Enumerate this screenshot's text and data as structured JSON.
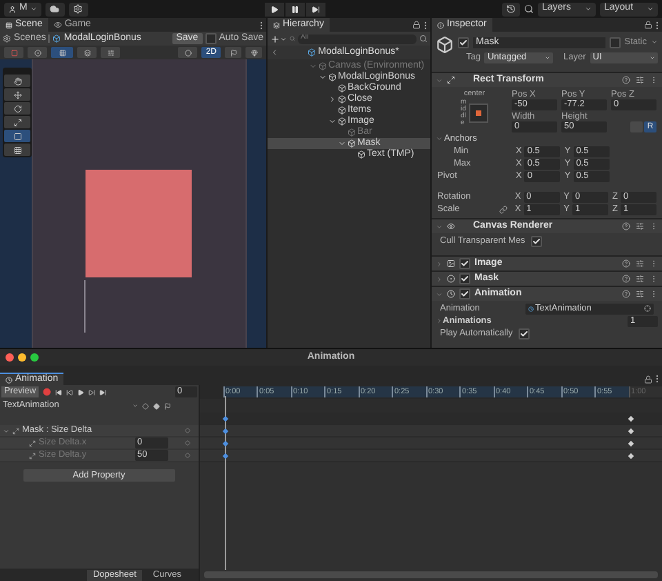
{
  "toolbar": {
    "account": "M",
    "layers": "Layers",
    "layout": "Layout"
  },
  "scene": {
    "tabs": [
      {
        "label": "Scene",
        "selected": true
      },
      {
        "label": "Game",
        "selected": false
      }
    ],
    "breadcrumb": [
      "Scenes",
      "ModalLoginBonus"
    ],
    "save": "Save",
    "auto_save": {
      "label": "Auto Save",
      "checked": false
    },
    "toggle_2d": {
      "label": "2D",
      "on": true
    },
    "tools": [
      {
        "kind": "hand",
        "selected": false
      },
      {
        "kind": "move",
        "selected": false
      },
      {
        "kind": "rotate",
        "selected": false
      },
      {
        "kind": "scale",
        "selected": false
      },
      {
        "kind": "rect",
        "selected": true
      },
      {
        "kind": "transform",
        "selected": false
      }
    ]
  },
  "hierarchy": {
    "title": "Hierarchy",
    "search": {
      "placeholder": "All"
    },
    "prefab": "ModalLoginBonus*",
    "tree": [
      {
        "label": "Canvas (Environment)",
        "disabled": true,
        "selected": false,
        "expanded": true,
        "children": [
          {
            "label": "ModalLoginBonus",
            "disabled": false,
            "selected": false,
            "expanded": true,
            "children": [
              {
                "label": "BackGround",
                "disabled": false,
                "selected": false
              },
              {
                "label": "Close",
                "disabled": false,
                "selected": false,
                "expanded": false
              },
              {
                "label": "Items",
                "disabled": false,
                "selected": false
              },
              {
                "label": "Image",
                "disabled": false,
                "selected": false,
                "expanded": true,
                "children": [
                  {
                    "label": "Bar",
                    "disabled": true,
                    "selected": false
                  },
                  {
                    "label": "Mask",
                    "disabled": false,
                    "selected": true,
                    "expanded": true,
                    "children": [
                      {
                        "label": "Text (TMP)",
                        "disabled": false,
                        "selected": false
                      }
                    ]
                  }
                ]
              }
            ]
          }
        ]
      }
    ]
  },
  "inspector": {
    "title": "Inspector",
    "object": {
      "name": "Mask",
      "active": true,
      "static": {
        "label": "Static",
        "checked": false
      },
      "tag": {
        "label": "Tag",
        "value": "Untagged"
      },
      "layer": {
        "label": "Layer",
        "value": "UI"
      }
    },
    "rect_transform": {
      "title": "Rect Transform",
      "expanded": true,
      "anchor_h": "center",
      "anchor_v": "middle",
      "raw_button": "R",
      "fields": [
        {
          "label": "Pos X",
          "value": "-50"
        },
        {
          "label": "Pos Y",
          "value": "-77.2"
        },
        {
          "label": "Pos Z",
          "value": "0"
        },
        {
          "label": "Width",
          "value": "0"
        },
        {
          "label": "Height",
          "value": "50"
        }
      ],
      "anchors": {
        "label": "Anchors",
        "expanded": true,
        "rows": [
          {
            "label": "Min",
            "axes": [
              {
                "axis": "X",
                "value": "0.5"
              },
              {
                "axis": "Y",
                "value": "0.5"
              }
            ]
          },
          {
            "label": "Max",
            "axes": [
              {
                "axis": "X",
                "value": "0.5"
              },
              {
                "axis": "Y",
                "value": "0.5"
              }
            ]
          }
        ]
      },
      "rows": [
        {
          "label": "Pivot",
          "linked": false,
          "axes": [
            {
              "axis": "X",
              "value": "0"
            },
            {
              "axis": "Y",
              "value": "0.5"
            }
          ]
        },
        {
          "label": "Rotation",
          "linked": false,
          "axes": [
            {
              "axis": "X",
              "value": "0"
            },
            {
              "axis": "Y",
              "value": "0"
            },
            {
              "axis": "Z",
              "value": "0"
            }
          ]
        },
        {
          "label": "Scale",
          "linked": true,
          "axes": [
            {
              "axis": "X",
              "value": "1"
            },
            {
              "axis": "Y",
              "value": "1"
            },
            {
              "axis": "Z",
              "value": "1"
            }
          ]
        }
      ]
    },
    "components": [
      {
        "title": "Canvas Renderer",
        "kind": "renderer",
        "expanded": true,
        "fields": [
          {
            "label": "Cull Transparent Mes",
            "kind": "check",
            "checked": true
          }
        ]
      },
      {
        "title": "Image",
        "kind": "image",
        "enabled": true,
        "expanded": false
      },
      {
        "title": "Mask",
        "kind": "mask",
        "enabled": true,
        "expanded": false
      },
      {
        "title": "Animation",
        "kind": "animation",
        "enabled": true,
        "expanded": true,
        "fields": [
          {
            "label": "Animation",
            "kind": "object",
            "value": "TextAnimation"
          },
          {
            "label": "Animations",
            "kind": "array",
            "expanded": false,
            "value": "1"
          },
          {
            "label": "Play Automatically",
            "kind": "check",
            "checked": true
          }
        ]
      }
    ]
  },
  "animation": {
    "window_title": "Animation",
    "tab": "Animation",
    "preview": "Preview",
    "frame": "0",
    "clip": "TextAnimation",
    "ticks": [
      {
        "label": "0:00",
        "in_range": true
      },
      {
        "label": "0:05",
        "in_range": true
      },
      {
        "label": "0:10",
        "in_range": true
      },
      {
        "label": "0:15",
        "in_range": true
      },
      {
        "label": "0:20",
        "in_range": true
      },
      {
        "label": "0:25",
        "in_range": true
      },
      {
        "label": "0:30",
        "in_range": true
      },
      {
        "label": "0:35",
        "in_range": true
      },
      {
        "label": "0:40",
        "in_range": true
      },
      {
        "label": "0:45",
        "in_range": true
      },
      {
        "label": "0:50",
        "in_range": true
      },
      {
        "label": "0:55",
        "in_range": true
      },
      {
        "label": "1:00",
        "in_range": false
      }
    ],
    "summary_keyframes": [
      {
        "kind": "start",
        "selected": true
      },
      {
        "kind": "end",
        "selected": false
      }
    ],
    "properties": [
      {
        "label": "Mask : Size Delta",
        "expanded": true,
        "keyframes": [
          {
            "kind": "start",
            "selected": true
          },
          {
            "kind": "end",
            "selected": false
          }
        ],
        "children": [
          {
            "label": "Size Delta.x",
            "value": "0",
            "keyframes": [
              {
                "kind": "start",
                "selected": true
              },
              {
                "kind": "end",
                "selected": false
              }
            ]
          },
          {
            "label": "Size Delta.y",
            "value": "50",
            "keyframes": [
              {
                "kind": "start",
                "selected": true
              },
              {
                "kind": "end",
                "selected": false
              }
            ]
          }
        ]
      }
    ],
    "add_property": "Add Property",
    "bottom_tabs": [
      {
        "label": "Dopesheet",
        "selected": true
      },
      {
        "label": "Curves",
        "selected": false
      }
    ]
  }
}
